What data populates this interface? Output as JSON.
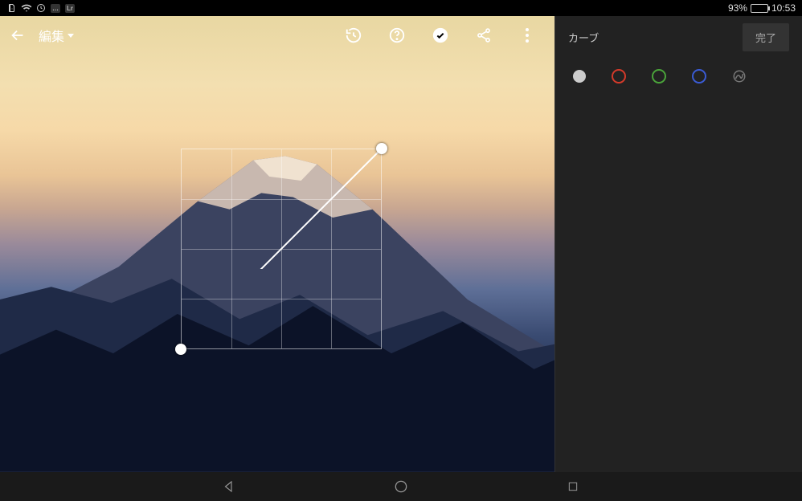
{
  "status": {
    "battery_pct": "93%",
    "time": "10:53"
  },
  "toolbar": {
    "edit_label": "編集"
  },
  "panel": {
    "title": "カーブ",
    "done_label": "完了"
  },
  "curve": {
    "channels": [
      "luminance",
      "red",
      "green",
      "blue",
      "parametric"
    ],
    "active_channel": "luminance",
    "points": [
      {
        "x": 0.0,
        "y": 0.0
      },
      {
        "x": 1.0,
        "y": 1.0
      }
    ]
  },
  "icons": {
    "back": "back-arrow-icon",
    "history": "history-icon",
    "help": "help-icon",
    "apply": "checkmark-circle-icon",
    "share": "share-icon",
    "overflow": "overflow-dots-icon",
    "nav_back": "nav-back-icon",
    "nav_home": "nav-home-icon",
    "nav_recent": "nav-recent-icon"
  }
}
